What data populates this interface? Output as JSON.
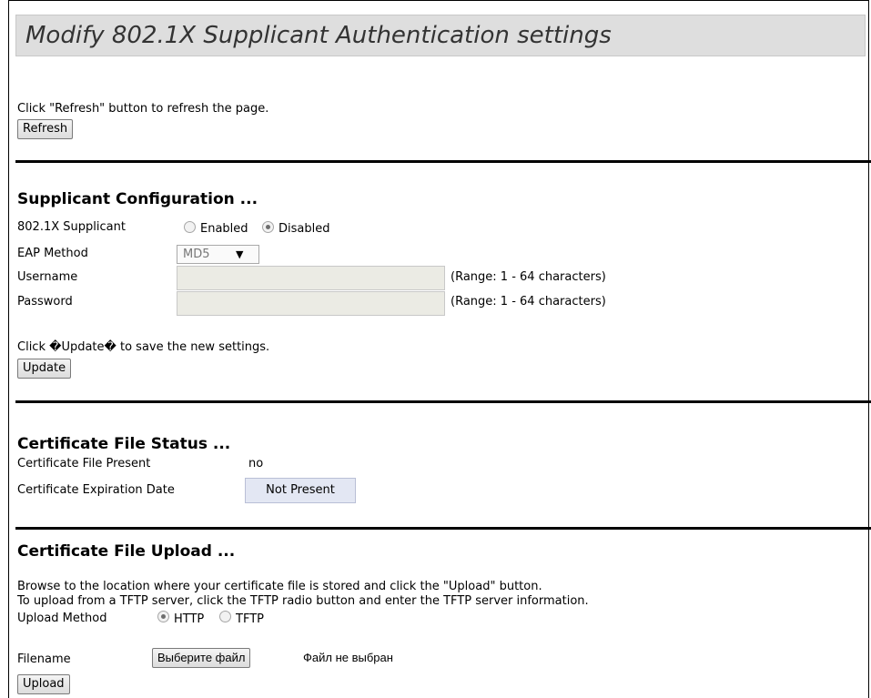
{
  "page": {
    "title": "Modify 802.1X Supplicant Authentication settings"
  },
  "refresh": {
    "instruction": "Click \"Refresh\" button to refresh the page.",
    "button_label": "Refresh"
  },
  "supplicant": {
    "heading": "Supplicant Configuration ...",
    "mode_label": "802.1X Supplicant",
    "enabled_label": "Enabled",
    "disabled_label": "Disabled",
    "selected_mode": "Disabled",
    "eap_label": "EAP Method",
    "eap_value": "MD5",
    "eap_arrow": "▼",
    "username_label": "Username",
    "username_value": "",
    "username_hint": "(Range: 1 - 64 characters)",
    "password_label": "Password",
    "password_value": "",
    "password_hint": "(Range: 1 - 64 characters)",
    "update_instruction": "Click �Update� to save the new settings.",
    "update_button_label": "Update"
  },
  "certificate_status": {
    "heading": "Certificate File Status ...",
    "present_label": "Certificate File Present",
    "present_value": "no",
    "expiration_label": "Certificate Expiration Date",
    "expiration_value": "Not Present"
  },
  "certificate_upload": {
    "heading": "Certificate File Upload ...",
    "instruction_line1": "Browse to the location where your certificate file is stored and click the \"Upload\" button.",
    "instruction_line2": "To upload from a TFTP server, click the TFTP radio button and enter the TFTP server information.",
    "method_label": "Upload Method",
    "http_label": "HTTP",
    "tftp_label": "TFTP",
    "selected_method": "HTTP",
    "filename_label": "Filename",
    "choose_file_label": "Выберите файл",
    "no_file_text": "Файл не выбран",
    "upload_button_label": "Upload"
  },
  "colors": {
    "title_bar": "#dedede",
    "status_box": "#e3e7f3",
    "disabled_input": "#ebebe4"
  }
}
